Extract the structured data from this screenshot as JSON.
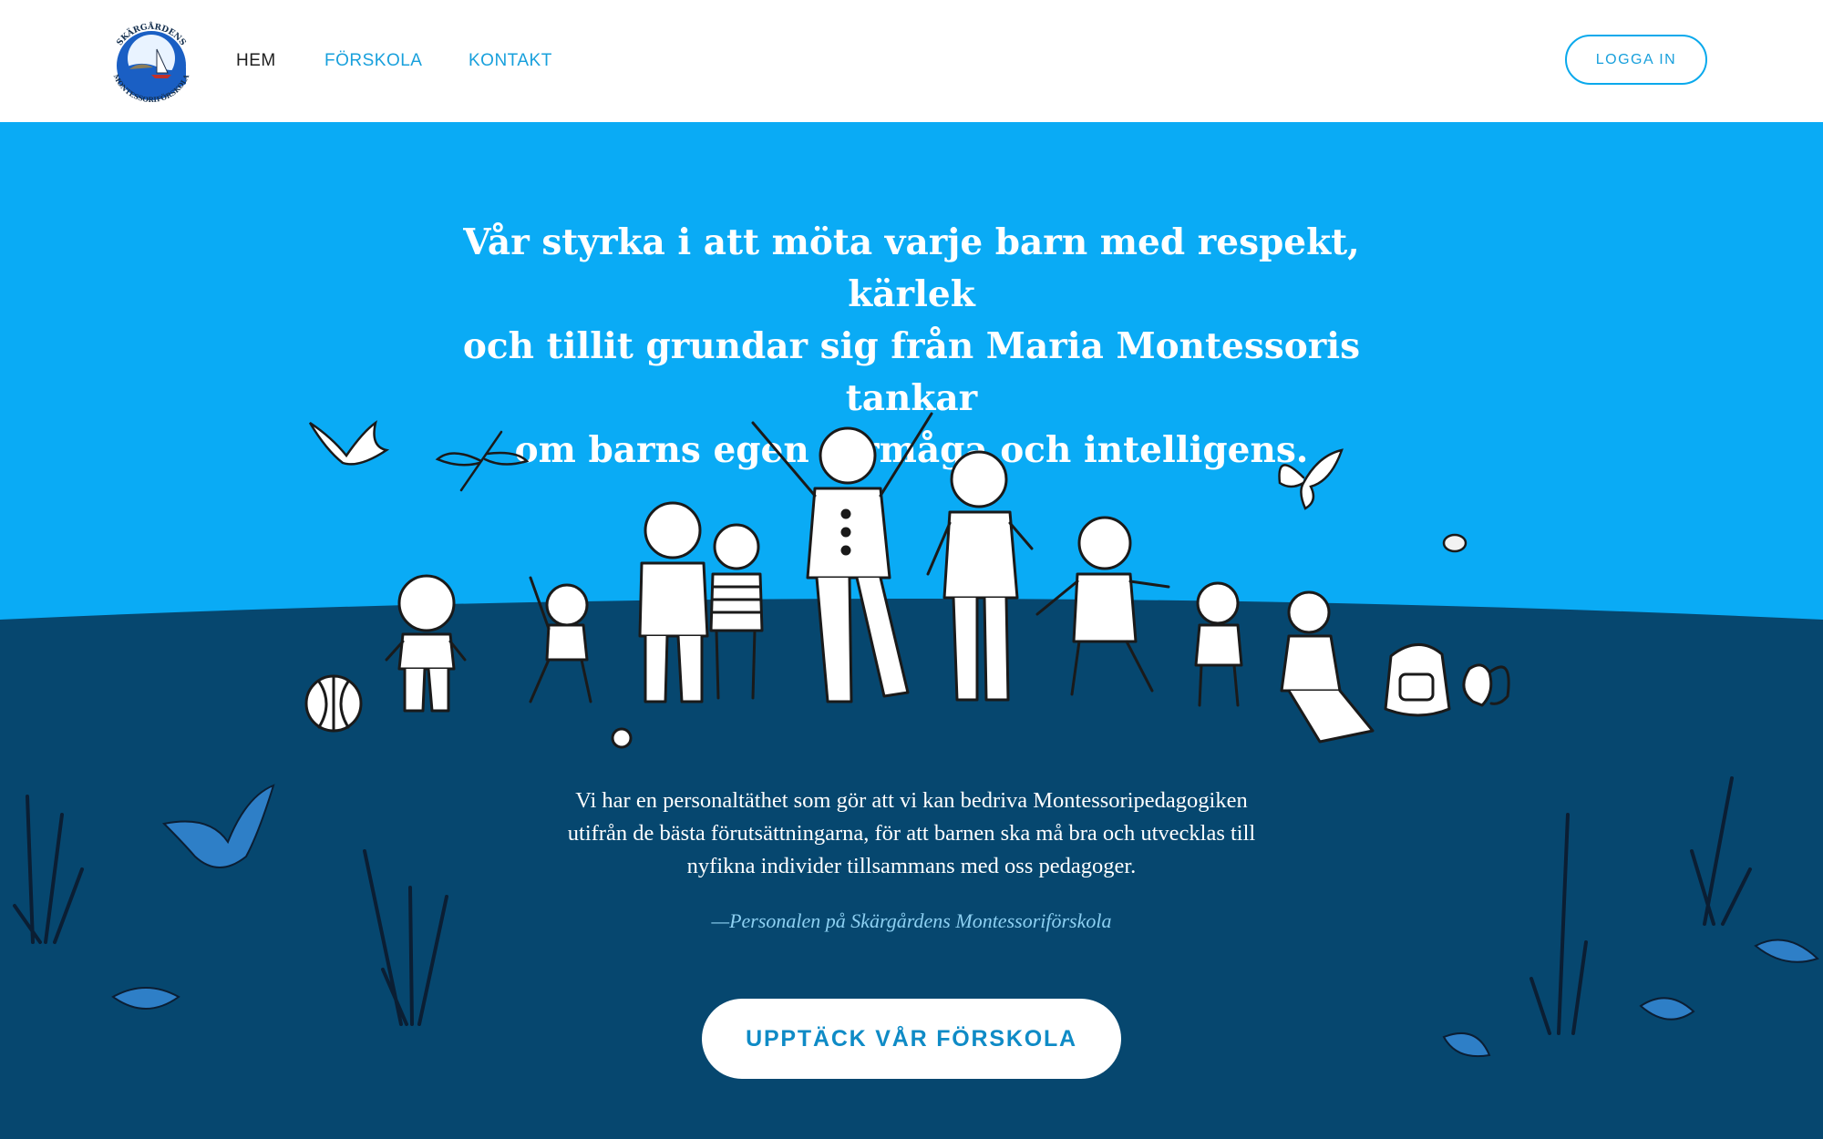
{
  "header": {
    "logo_text_top": "SKÄRGÅRDENS",
    "logo_text_bottom": "MONTESSORIFÖRSKOLA",
    "nav": [
      {
        "label": "HEM",
        "active": true
      },
      {
        "label": "FÖRSKOLA",
        "active": false
      },
      {
        "label": "KONTAKT",
        "active": false
      }
    ],
    "login_label": "LOGGA IN"
  },
  "hero": {
    "headline_lines": [
      "Vår styrka i att möta varje barn med respekt, kärlek",
      "och tillit grundar sig från Maria Montessoris tankar",
      "om barns egen förmåga och intelligens."
    ],
    "quote_lines": [
      "Vi har en personaltäthet som gör att vi kan bedriva Montessoripedagogiken",
      "utifrån de bästa förutsättningarna, för att barnen ska må bra och utvecklas till",
      "nyfikna individer tillsammans med oss pedagoger."
    ],
    "signature": "—Personalen på Skärgårdens Montessoriförskola",
    "cta_label": "UPPTÄCK VÅR FÖRSKOLA"
  },
  "colors": {
    "sky": "#0aabf5",
    "ground": "#06476f",
    "accent": "#18a0dc",
    "white": "#ffffff"
  },
  "icons": [
    "logo-emblem",
    "bird-icon",
    "dragonfly-icon",
    "butterfly-icon",
    "bee-icon",
    "grass-icon",
    "leaf-icon",
    "blue-bird-icon"
  ]
}
